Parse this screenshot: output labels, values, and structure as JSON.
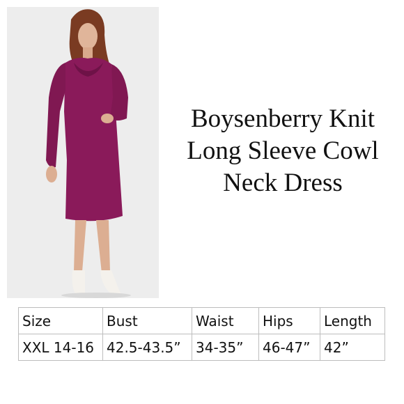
{
  "product": {
    "title_lines": [
      "Boysenberry Knit",
      "Long Sleeve Cowl",
      "Neck Dress"
    ],
    "color": "#8a1a5a"
  },
  "photo": {
    "description_icon": "model-wearing-dress-image"
  },
  "size_chart": {
    "headers": [
      "Size",
      "Bust",
      "Waist",
      "Hips",
      "Length"
    ],
    "rows": [
      [
        "XXL 14-16",
        "42.5-43.5”",
        "34-35”",
        "46-47”",
        "42”"
      ]
    ]
  }
}
